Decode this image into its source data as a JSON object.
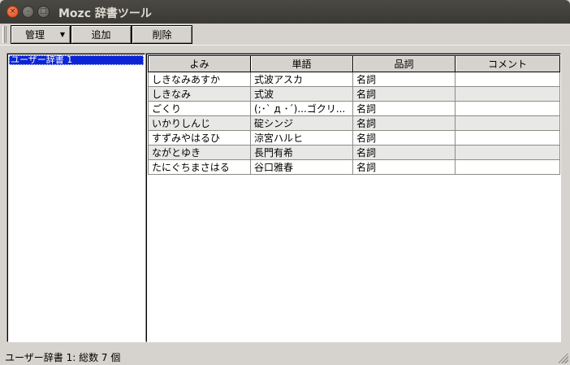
{
  "window": {
    "title": "Mozc 辞書ツール",
    "close_glyph": "×",
    "min_glyph": "–",
    "max_glyph": "□"
  },
  "toolbar": {
    "manage_label": "管理",
    "manage_arrow": "▼",
    "add_label": "追加",
    "delete_label": "削除"
  },
  "dictionaries": [
    {
      "label": "ユーザー辞書 1",
      "selected": true
    }
  ],
  "table": {
    "columns": [
      "よみ",
      "単語",
      "品詞",
      "コメント"
    ],
    "rows": [
      [
        "しきなみあすか",
        "式波アスカ",
        "名詞",
        ""
      ],
      [
        "しきなみ",
        "式波",
        "名詞",
        ""
      ],
      [
        "ごくり",
        "(;･` д ･´)...ゴクリ...",
        "名詞",
        ""
      ],
      [
        "いかりしんじ",
        "碇シンジ",
        "名詞",
        ""
      ],
      [
        "すずみやはるひ",
        "涼宮ハルヒ",
        "名詞",
        ""
      ],
      [
        "ながとゆき",
        "長門有希",
        "名詞",
        ""
      ],
      [
        "たにぐちまさはる",
        "谷口雅春",
        "名詞",
        ""
      ]
    ]
  },
  "status": {
    "text": "ユーザー辞書 1: 総数 7 個"
  }
}
